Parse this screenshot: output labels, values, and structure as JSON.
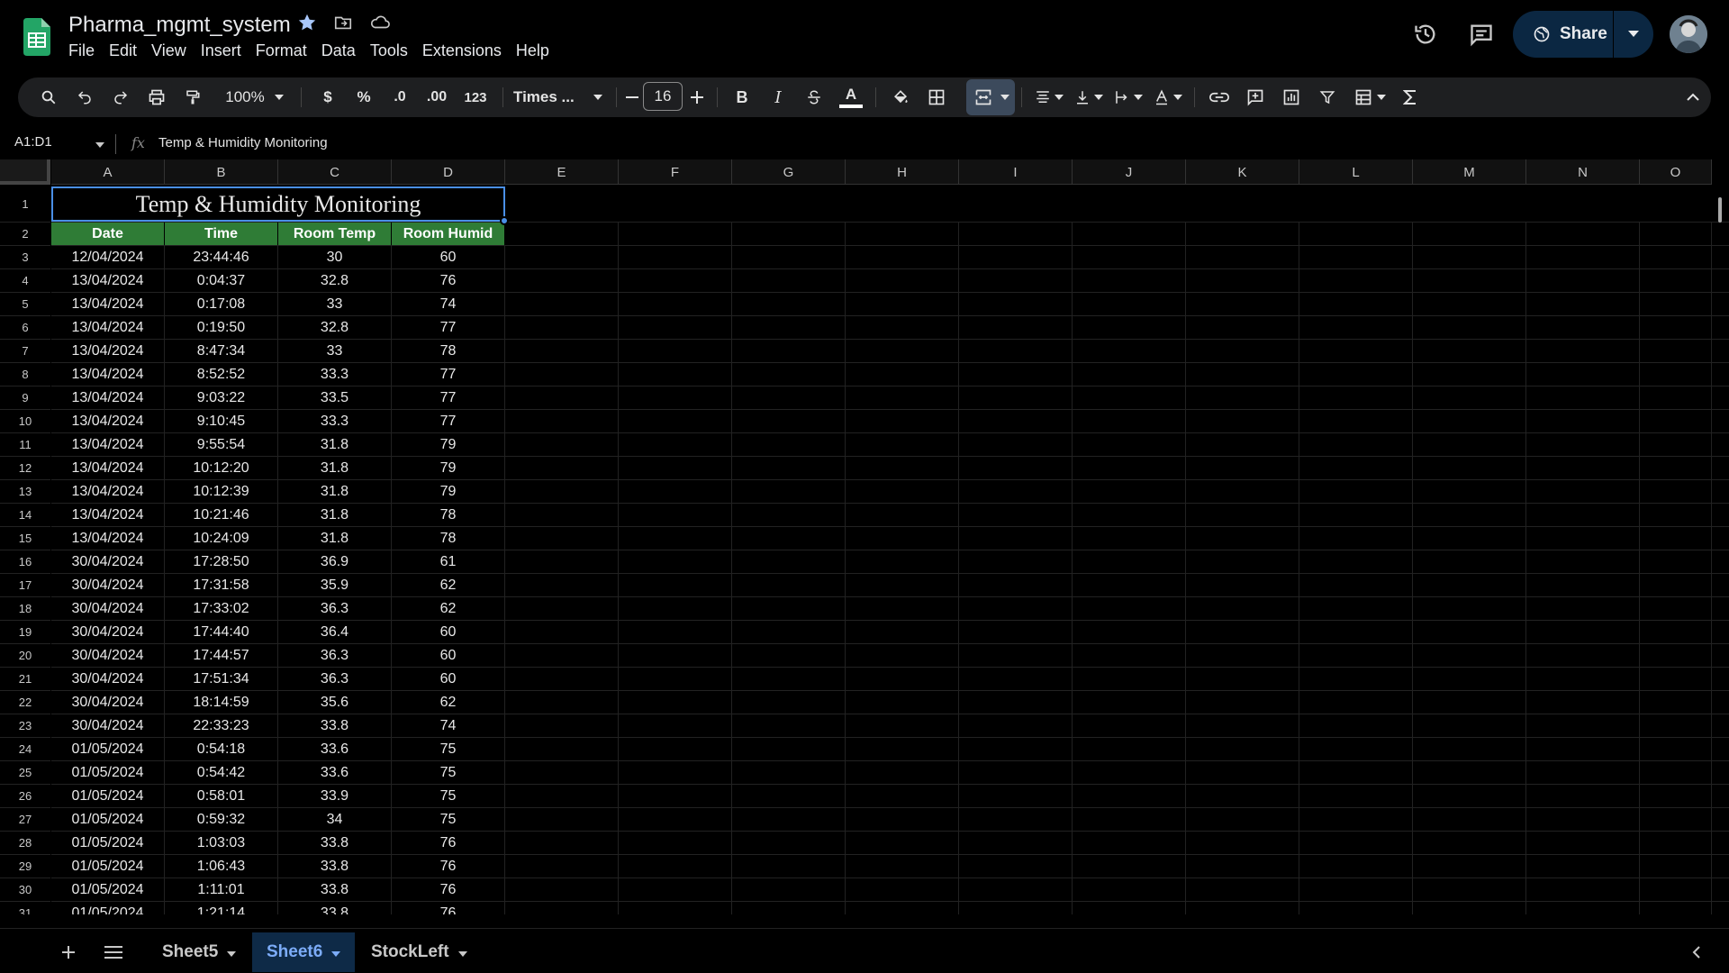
{
  "header": {
    "doc_title": "Pharma_mgmt_system",
    "menu": [
      "File",
      "Edit",
      "View",
      "Insert",
      "Format",
      "Data",
      "Tools",
      "Extensions",
      "Help"
    ],
    "share_label": "Share"
  },
  "toolbar": {
    "zoom": "100%",
    "currency": "$",
    "percent": "%",
    "decrease_decimal": ".0",
    "increase_decimal": ".00",
    "number_format": "123",
    "font_family": "Times ...",
    "font_size": "16",
    "bold": "B",
    "italic": "I",
    "text_color_letter": "A"
  },
  "formula_bar": {
    "cell_ref": "A1:D1",
    "fx": "fx",
    "content": "Temp & Humidity Monitoring"
  },
  "columns": [
    "A",
    "B",
    "C",
    "D",
    "E",
    "F",
    "G",
    "H",
    "I",
    "J",
    "K",
    "L",
    "M",
    "N",
    "O"
  ],
  "sheet": {
    "title": "Temp & Humidity Monitoring",
    "headers": [
      "Date",
      "Time",
      "Room Temp",
      "Room Humid"
    ],
    "rows": [
      [
        "12/04/2024",
        "23:44:46",
        "30",
        "60"
      ],
      [
        "13/04/2024",
        "0:04:37",
        "32.8",
        "76"
      ],
      [
        "13/04/2024",
        "0:17:08",
        "33",
        "74"
      ],
      [
        "13/04/2024",
        "0:19:50",
        "32.8",
        "77"
      ],
      [
        "13/04/2024",
        "8:47:34",
        "33",
        "78"
      ],
      [
        "13/04/2024",
        "8:52:52",
        "33.3",
        "77"
      ],
      [
        "13/04/2024",
        "9:03:22",
        "33.5",
        "77"
      ],
      [
        "13/04/2024",
        "9:10:45",
        "33.3",
        "77"
      ],
      [
        "13/04/2024",
        "9:55:54",
        "31.8",
        "79"
      ],
      [
        "13/04/2024",
        "10:12:20",
        "31.8",
        "79"
      ],
      [
        "13/04/2024",
        "10:12:39",
        "31.8",
        "79"
      ],
      [
        "13/04/2024",
        "10:21:46",
        "31.8",
        "78"
      ],
      [
        "13/04/2024",
        "10:24:09",
        "31.8",
        "78"
      ],
      [
        "30/04/2024",
        "17:28:50",
        "36.9",
        "61"
      ],
      [
        "30/04/2024",
        "17:31:58",
        "35.9",
        "62"
      ],
      [
        "30/04/2024",
        "17:33:02",
        "36.3",
        "62"
      ],
      [
        "30/04/2024",
        "17:44:40",
        "36.4",
        "60"
      ],
      [
        "30/04/2024",
        "17:44:57",
        "36.3",
        "60"
      ],
      [
        "30/04/2024",
        "17:51:34",
        "36.3",
        "60"
      ],
      [
        "30/04/2024",
        "18:14:59",
        "35.6",
        "62"
      ],
      [
        "30/04/2024",
        "22:33:23",
        "33.8",
        "74"
      ],
      [
        "01/05/2024",
        "0:54:18",
        "33.6",
        "75"
      ],
      [
        "01/05/2024",
        "0:54:42",
        "33.6",
        "75"
      ],
      [
        "01/05/2024",
        "0:58:01",
        "33.9",
        "75"
      ],
      [
        "01/05/2024",
        "0:59:32",
        "34",
        "75"
      ],
      [
        "01/05/2024",
        "1:03:03",
        "33.8",
        "76"
      ],
      [
        "01/05/2024",
        "1:06:43",
        "33.8",
        "76"
      ],
      [
        "01/05/2024",
        "1:11:01",
        "33.8",
        "76"
      ],
      [
        "01/05/2024",
        "1:21:14",
        "33.8",
        "76"
      ]
    ]
  },
  "sheet_tabs": [
    {
      "label": "Sheet5",
      "active": false
    },
    {
      "label": "Sheet6",
      "active": true
    },
    {
      "label": "StockLeft",
      "active": false
    }
  ],
  "colors": {
    "header_green": "#2f7c36",
    "selection_blue": "#4a8fe7",
    "active_tab_text": "#7cacf8"
  }
}
